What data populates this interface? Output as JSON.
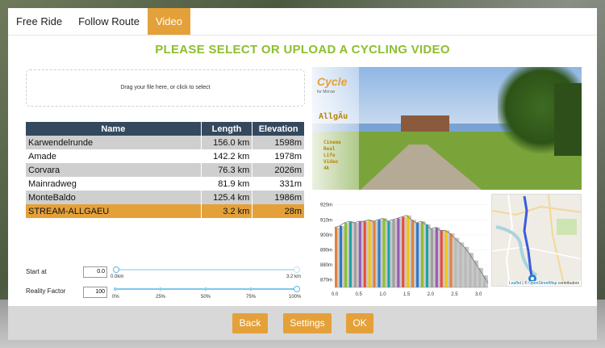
{
  "tabs": [
    {
      "label": "Free Ride",
      "active": false
    },
    {
      "label": "Follow Route",
      "active": false
    },
    {
      "label": "Video",
      "active": true
    }
  ],
  "title": "PLEASE SELECT OR UPLOAD A CYCLING VIDEO",
  "dropzone": {
    "text": "Drag your file here, or click to select"
  },
  "table": {
    "headers": [
      "Name",
      "Length",
      "Elevation"
    ],
    "rows": [
      {
        "name": "Karwendelrunde",
        "length": "156.0 km",
        "elevation": "1598m",
        "selected": false
      },
      {
        "name": "Amade",
        "length": "142.2 km",
        "elevation": "1978m",
        "selected": false
      },
      {
        "name": "Corvara",
        "length": "76.3 km",
        "elevation": "2026m",
        "selected": false
      },
      {
        "name": "Mainradweg",
        "length": "81.9 km",
        "elevation": "331m",
        "selected": false
      },
      {
        "name": "MonteBaldo",
        "length": "125.4 km",
        "elevation": "1986m",
        "selected": false
      },
      {
        "name": "STREAM-ALLGAEU",
        "length": "3.2 km",
        "elevation": "28m",
        "selected": true
      }
    ]
  },
  "controls": {
    "start_at": {
      "label": "Start at",
      "value": "0.0",
      "min_label": "0.0km",
      "max_label": "3.2 km",
      "position": 0.0
    },
    "reality_factor": {
      "label": "Reality Factor",
      "value": "100",
      "ticks": [
        "0%",
        "25%",
        "50%",
        "75%",
        "100%"
      ],
      "position": 1.0
    }
  },
  "video_preview": {
    "logo": "Cycle",
    "logo_sub": "for Mirrow",
    "name": "AllgÄu",
    "info": "Cinema\nReal\nLife\nVideo\n4k"
  },
  "chart_data": {
    "type": "area",
    "xlabel": "",
    "ylabel": "",
    "xlim": [
      0,
      3.2
    ],
    "ylim": [
      865,
      922
    ],
    "x_ticks": [
      "0.0",
      "0.5",
      "1.0",
      "1.5",
      "2.0",
      "2.5",
      "3.0"
    ],
    "y_ticks": [
      "870m",
      "880m",
      "890m",
      "900m",
      "910m",
      "920m"
    ],
    "x": [
      0.0,
      0.1,
      0.2,
      0.3,
      0.4,
      0.5,
      0.6,
      0.7,
      0.8,
      0.9,
      1.0,
      1.1,
      1.2,
      1.3,
      1.4,
      1.5,
      1.6,
      1.7,
      1.8,
      1.9,
      2.0,
      2.1,
      2.2,
      2.3,
      2.4,
      2.5,
      2.6,
      2.7,
      2.8,
      2.9,
      3.0,
      3.1,
      3.2
    ],
    "y": [
      905,
      906,
      908,
      909,
      908,
      909,
      909,
      910,
      909,
      910,
      911,
      909,
      910,
      911,
      912,
      913,
      910,
      908,
      909,
      907,
      904,
      905,
      903,
      903,
      901,
      898,
      895,
      892,
      888,
      883,
      878,
      873,
      868
    ],
    "colors": [
      "#e0813a",
      "#2f79c8",
      "#8cbf2d",
      "#1fa3a3",
      "#a0a0a0",
      "#9b59b6",
      "#e74c3c",
      "#f1c40f"
    ]
  },
  "map": {
    "attribution_link1": "Leaflet",
    "attribution_sep": " | © ",
    "attribution_link2": "OpenStreetMap",
    "attribution_tail": " contributors"
  },
  "buttons": {
    "back": "Back",
    "settings": "Settings",
    "ok": "OK"
  }
}
